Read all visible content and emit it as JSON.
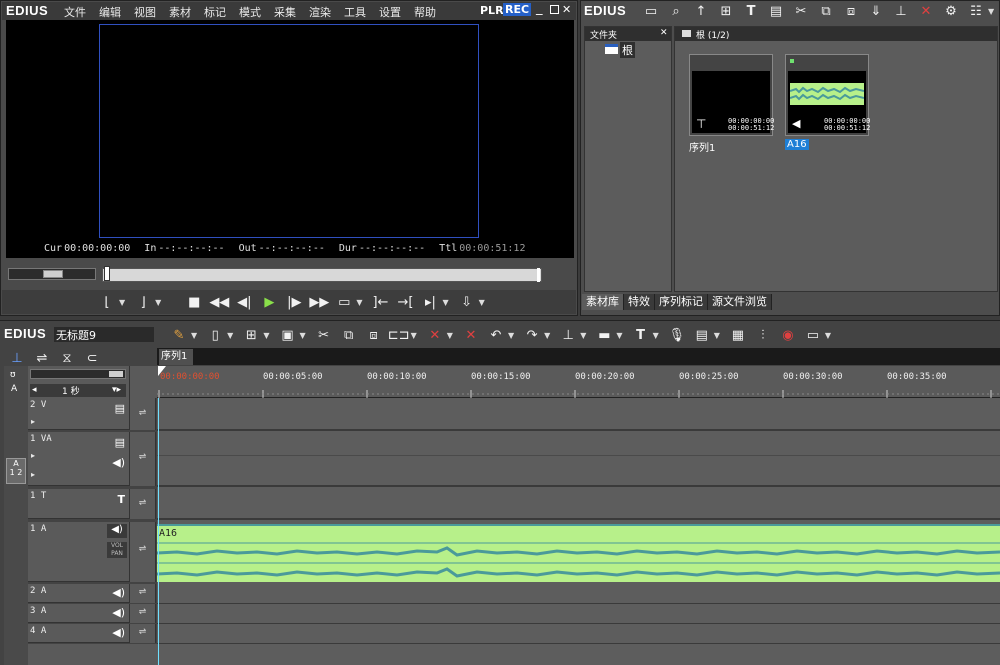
{
  "player": {
    "brand": "EDIUS",
    "menu": [
      "文件",
      "编辑",
      "视图",
      "素材",
      "标记",
      "模式",
      "采集",
      "渲染",
      "工具",
      "设置",
      "帮助"
    ],
    "plr": "PLR",
    "rec": "REC",
    "timecodes": [
      {
        "label": "Cur",
        "value": "00:00:00:00"
      },
      {
        "label": "In",
        "value": "--:--:--:--"
      },
      {
        "label": "Out",
        "value": "--:--:--:--"
      },
      {
        "label": "Dur",
        "value": "--:--:--:--"
      },
      {
        "label": "Ttl",
        "value": "00:00:51:12"
      }
    ]
  },
  "bin": {
    "brand": "EDIUS",
    "folder_header": "文件夹",
    "close": "✕",
    "root_label": "根",
    "path_label": "根 (1/2)",
    "clips": [
      {
        "name": "序列1",
        "tc_in": "00:00:00:00",
        "tc_out": "00:00:51:12"
      },
      {
        "name": "A16",
        "tc_in": "00:00:00:00",
        "tc_out": "00:00:51:12"
      }
    ],
    "tabs": [
      "素材库",
      "特效",
      "序列标记",
      "源文件浏览"
    ]
  },
  "timeline": {
    "brand": "EDIUS",
    "project": "无标题9",
    "sequence_tab": "序列1",
    "scale": "1 秒",
    "ruler": [
      "00:00:00:00",
      "00:00:05:00",
      "00:00:10:00",
      "00:00:15:00",
      "00:00:20:00",
      "00:00:25:00",
      "00:00:30:00",
      "00:00:35:00"
    ],
    "tracks": {
      "v2": "2 V",
      "va1": "1 VA",
      "t1": "1 T",
      "a1": "1 A",
      "a2": "2 A",
      "a3": "3 A",
      "a4": "4 A"
    },
    "side_label_a": "A",
    "side_label_12": "1 2",
    "clip_name": "A16",
    "vol": "VOL",
    "pan": "PAN",
    "colors": {
      "clip": "#b7f08a",
      "wave": "#4a9a9a",
      "select": "#1e7fd6"
    }
  }
}
